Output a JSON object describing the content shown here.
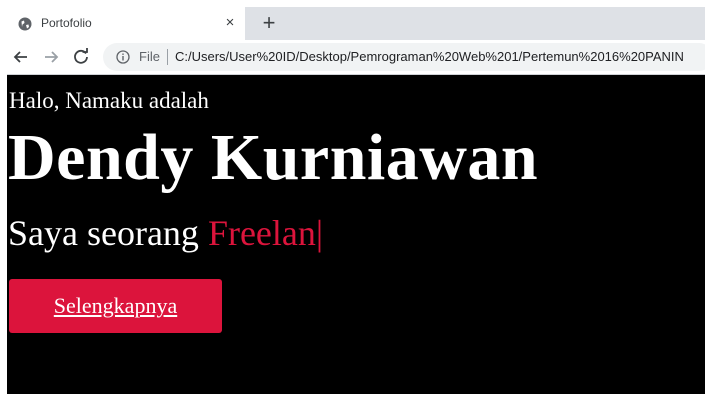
{
  "browser": {
    "tab": {
      "title": "Portofolio",
      "favicon": "globe-icon",
      "close_glyph": "×"
    },
    "new_tab_glyph": "+",
    "address_bar": {
      "scheme_label": "File",
      "url": "C:/Users/User%20ID/Desktop/Pemrograman%20Web%201/Pertemun%2016%20PANIN"
    }
  },
  "page": {
    "greeting": "Halo, Namaku adalah",
    "name": "Dendy Kurniawan",
    "role_prefix": "Saya seorang ",
    "role_typed": "Freelan",
    "caret": "|",
    "cta_label": "Selengkapnya",
    "colors": {
      "background": "#000000",
      "text": "#ffffff",
      "accent": "#dc143c"
    }
  }
}
